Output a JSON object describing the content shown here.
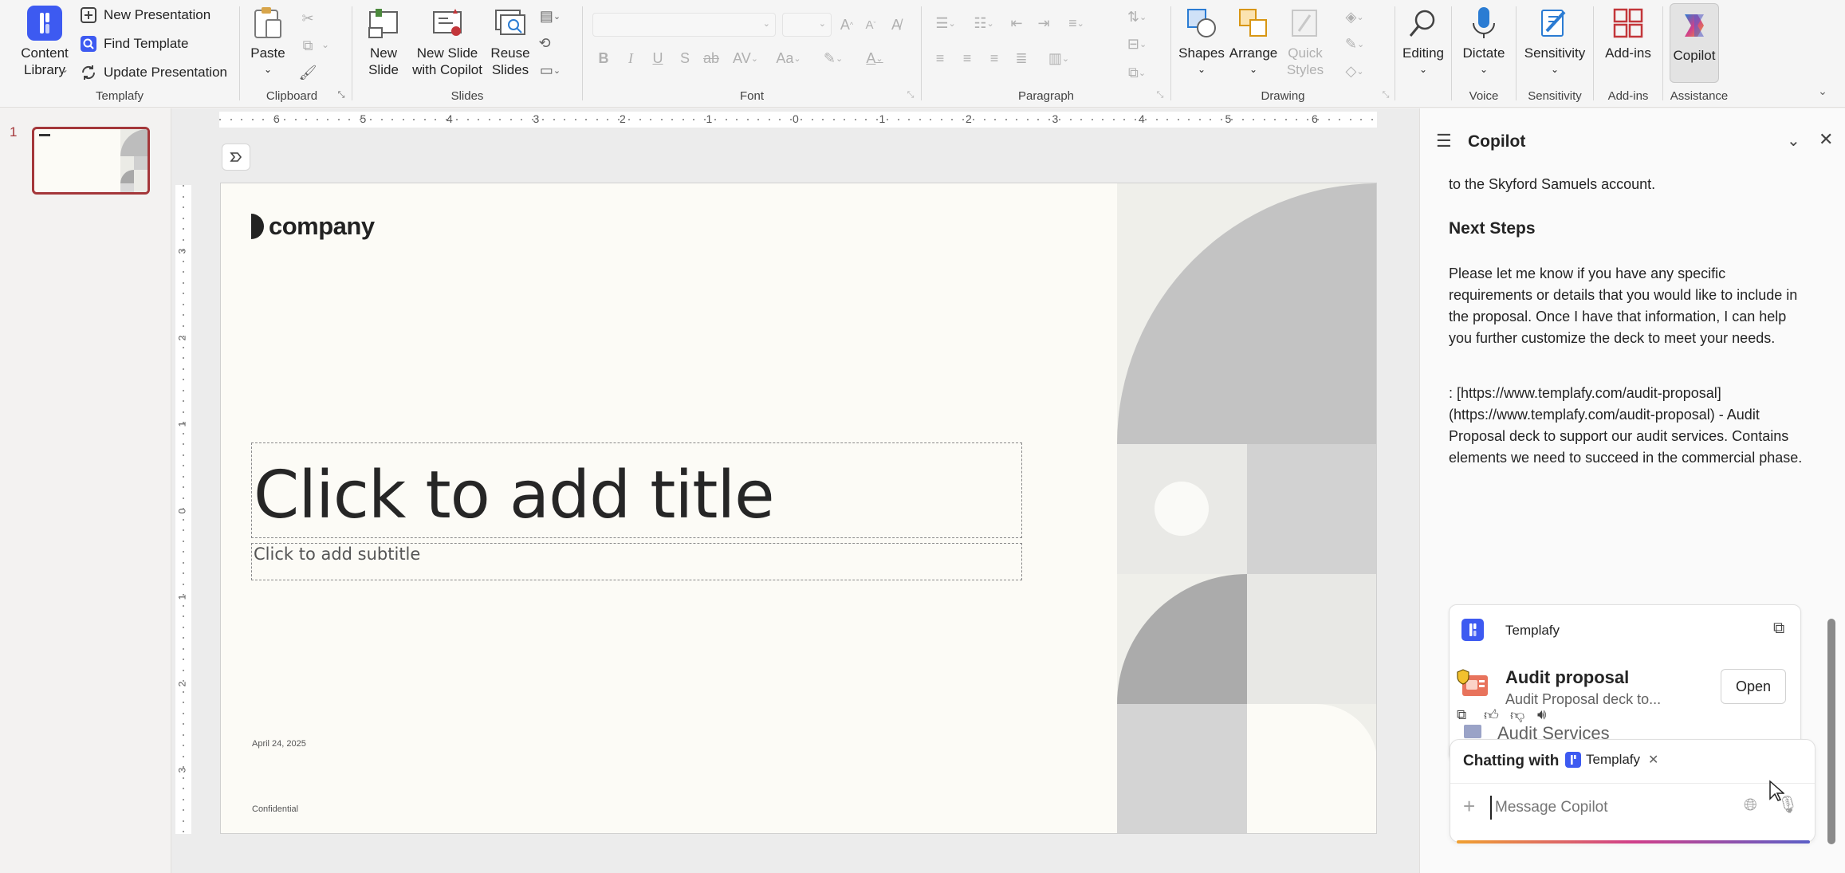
{
  "ribbon": {
    "templafy": {
      "content_library": "Content\nLibrary",
      "new_presentation": "New Presentation",
      "find_template": "Find Template",
      "update_presentation": "Update Presentation",
      "group_label": "Templafy"
    },
    "clipboard": {
      "paste": "Paste",
      "group_label": "Clipboard"
    },
    "slides": {
      "new_slide": "New\nSlide",
      "new_slide_copilot": "New Slide\nwith Copilot",
      "reuse_slides": "Reuse\nSlides",
      "group_label": "Slides"
    },
    "font": {
      "group_label": "Font"
    },
    "paragraph": {
      "group_label": "Paragraph"
    },
    "drawing": {
      "shapes": "Shapes",
      "arrange": "Arrange",
      "quick_styles": "Quick\nStyles",
      "group_label": "Drawing"
    },
    "editing": {
      "label": "Editing"
    },
    "voice": {
      "dictate": "Dictate",
      "group_label": "Voice"
    },
    "sensitivity": {
      "label": "Sensitivity",
      "group_label": "Sensitivity"
    },
    "addins": {
      "label": "Add-ins",
      "group_label": "Add-ins"
    },
    "assistance": {
      "copilot": "Copilot",
      "group_label": "Assistance"
    }
  },
  "thumbnails": [
    {
      "number": "1"
    }
  ],
  "rulers": {
    "horizontal": [
      "6",
      "5",
      "4",
      "3",
      "2",
      "1",
      "0",
      "1",
      "2",
      "3",
      "4",
      "5",
      "6"
    ],
    "vertical": [
      "3",
      "2",
      "1",
      "0",
      "1",
      "2",
      "3"
    ]
  },
  "slide": {
    "logo_text": "company",
    "title_placeholder": "Click to add title",
    "subtitle_placeholder": "Click to add subtitle",
    "date": "April 24, 2025",
    "footer": "Confidential"
  },
  "copilot": {
    "title": "Copilot",
    "intro_tail": "to the Skyford Samuels account.",
    "next_steps_heading": "Next Steps",
    "paragraph1": "Please let me know if you have any specific requirements or details that you would like to include in the proposal. Once I have that information, I can help you further customize the deck to meet your needs.",
    "paragraph2": ": [https://www.templafy.com/audit-proposal](https://www.templafy.com/audit-proposal) - Audit Proposal deck to support our audit services. Contains elements we need to succeed in the commercial phase.",
    "card": {
      "source": "Templafy",
      "item_title": "Audit proposal",
      "item_desc": "Audit Proposal deck to...",
      "open_label": "Open",
      "folder": "Audit Services"
    },
    "chatting_with": "Chatting with",
    "chip_label": "Templafy",
    "input_placeholder": "Message Copilot"
  },
  "colors": {
    "accent_red": "#a4373a",
    "templafy_blue": "#3d5af1",
    "copilot_gradient": [
      "#f0a030",
      "#d03f8a",
      "#5b5fc7"
    ]
  }
}
